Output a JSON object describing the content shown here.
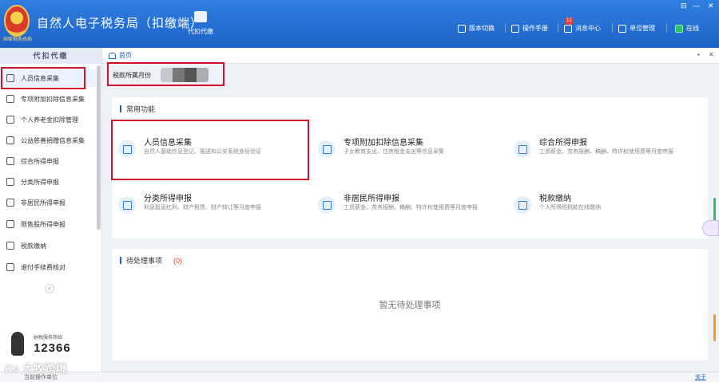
{
  "app": {
    "emblem_caption": "国家税务总局",
    "title": "自然人电子税务局（扣缴端）",
    "proxy_label": "代扣代缴"
  },
  "toolbar": {
    "version_switch": "版本切换",
    "manual": "操作手册",
    "message_center": "消息中心",
    "message_badge": "12",
    "unit_manage": "单位管理",
    "online": "在线"
  },
  "window_controls": [
    "⊟",
    "—",
    "✕"
  ],
  "sidebar": {
    "header": "代扣代缴",
    "items": [
      {
        "label": "人员信息采集",
        "icon": "person-icon"
      },
      {
        "label": "专项附加扣除信息采集",
        "icon": "list-icon"
      },
      {
        "label": "个人养老金扣除管理",
        "icon": "card-icon"
      },
      {
        "label": "公益慈善捐赠信息采集",
        "icon": "charity-icon"
      },
      {
        "label": "综合所得申报",
        "icon": "layers-icon"
      },
      {
        "label": "分类所得申报",
        "icon": "pie-icon"
      },
      {
        "label": "非居民所得申报",
        "icon": "globe-icon"
      },
      {
        "label": "限售股所得申报",
        "icon": "bar-chart-icon"
      },
      {
        "label": "税款缴纳",
        "icon": "wallet-icon"
      },
      {
        "label": "退付手续费核对",
        "icon": "document-icon"
      }
    ],
    "collapse": "«",
    "hotline_label": "纳税服务热线",
    "hotline_number": "12366"
  },
  "tabs": {
    "home": "首页",
    "controls": [
      "▪",
      "✕"
    ]
  },
  "period": {
    "label": "税款所属月份"
  },
  "common": {
    "title": "常用功能",
    "functions": [
      {
        "name": "人员信息采集",
        "desc": "自然人基础信息登记、报送和公安系统身份验证"
      },
      {
        "name": "专项附加扣除信息采集",
        "desc": "子女教育支出，住房租金支出等信息采集"
      },
      {
        "name": "综合所得申报",
        "desc": "工资薪金、劳务报酬、稿酬、特许权使用费等月度申报"
      },
      {
        "name": "分类所得申报",
        "desc": "利息股息红利、财产租赁、财产转让等月度申报"
      },
      {
        "name": "非居民所得申报",
        "desc": "工资薪金、劳务报酬、稿酬、特许权使用费等月度申报"
      },
      {
        "name": "税款缴纳",
        "desc": "个人所得税税款在线缴纳"
      }
    ]
  },
  "pending": {
    "title": "待处理事项",
    "count": "(0)",
    "empty": "暂无待处理事项"
  },
  "statusbar": {
    "left": "当前操作单位",
    "right": "关于"
  },
  "watermark": "Kc 大牧跨境",
  "colors": {
    "brand": "#1e63c7",
    "highlight": "#d0102c",
    "badge": "#e53935"
  }
}
